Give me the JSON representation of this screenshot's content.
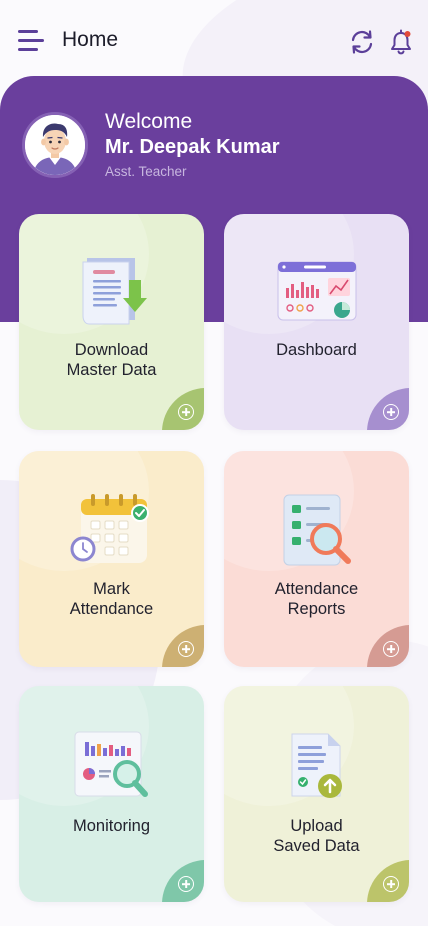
{
  "topbar": {
    "title": "Home",
    "menu_icon": "hamburger-menu-icon",
    "sync_icon": "sync-icon",
    "notification_icon": "bell-icon"
  },
  "profile": {
    "welcome": "Welcome",
    "name": "Mr. Deepak Kumar",
    "role": "Asst. Teacher",
    "avatar": "avatar-icon"
  },
  "tiles": [
    {
      "label": "Download\nMaster Data",
      "icon": "download-document-icon",
      "bg": "#e6f1d3",
      "corner": "#a7c471"
    },
    {
      "label": "Dashboard",
      "icon": "dashboard-chart-icon",
      "bg": "#e8e0f4",
      "corner": "#a68fcf"
    },
    {
      "label": "Mark\nAttendance",
      "icon": "calendar-clock-icon",
      "bg": "#faeccb",
      "corner": "#cdb073"
    },
    {
      "label": "Attendance\nReports",
      "icon": "report-search-icon",
      "bg": "#fbdcd6",
      "corner": "#d59b93"
    },
    {
      "label": "Monitoring",
      "icon": "monitoring-magnifier-icon",
      "bg": "#d8efe6",
      "corner": "#7fc7a9"
    },
    {
      "label": "Upload\nSaved Data",
      "icon": "upload-document-icon",
      "bg": "#eff1d8",
      "corner": "#bcc46a"
    }
  ],
  "colors": {
    "accent": "#6a3f9d",
    "notification_dot": "#e24a3b"
  }
}
